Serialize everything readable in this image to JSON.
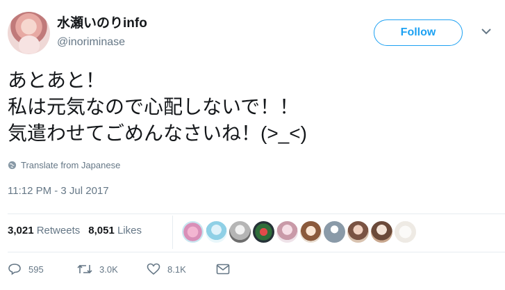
{
  "user": {
    "name": "水瀬いのりinfo",
    "handle": "@inoriminase"
  },
  "follow_label": "Follow",
  "tweet_lines": [
    "あとあと！",
    "私は元気なので心配しないで！！",
    "気遣わせてごめんなさいね！(>_<)"
  ],
  "translate_label": "Translate from Japanese",
  "timestamp": "11:12 PM - 3 Jul 2017",
  "stats": {
    "retweets_count": "3,021",
    "retweets_label": "Retweets",
    "likes_count": "8,051",
    "likes_label": "Likes"
  },
  "actions": {
    "replies": "595",
    "retweets": "3.0K",
    "likes": "8.1K"
  },
  "colors": {
    "accent": "#1da1f2",
    "muted": "#657786"
  },
  "icons": [
    "chevron-down-icon",
    "globe-icon",
    "reply-icon",
    "retweet-icon",
    "heart-icon",
    "envelope-icon"
  ]
}
